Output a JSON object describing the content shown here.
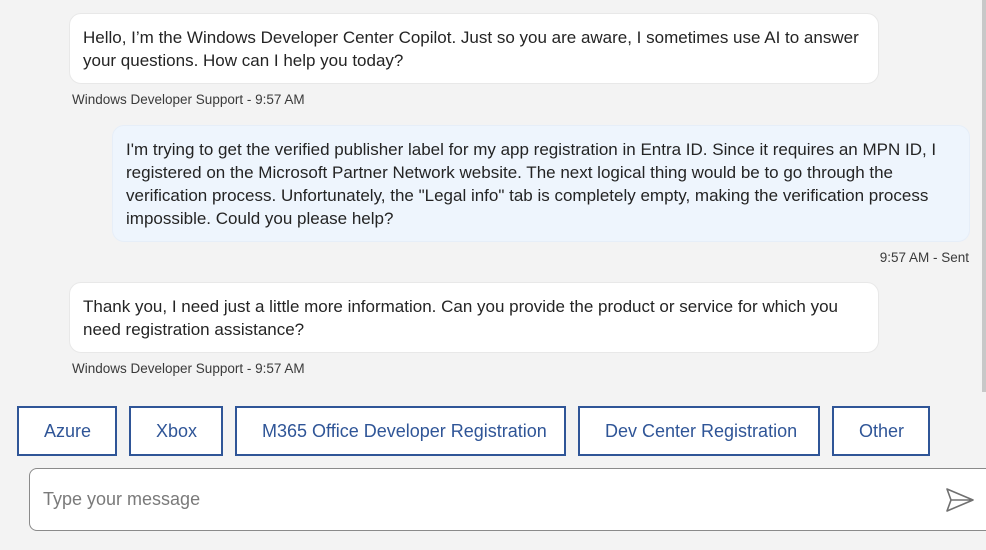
{
  "messages": [
    {
      "text": "Hello, I’m the Windows Developer Center Copilot. Just so you are aware, I sometimes use AI to answer your questions. How can I help you today?",
      "meta": "Windows Developer Support - 9:57 AM"
    },
    {
      "text": "I'm trying to get the verified publisher label for my app registration in Entra ID. Since it requires an MPN ID, I registered on the Microsoft Partner Network website. The next logical thing would be to go through the verification process. Unfortunately, the \"Legal info\" tab is completely empty, making the verification process impossible. Could you please help?",
      "meta": "9:57 AM - Sent"
    },
    {
      "text": "Thank you, I need just a little more information. Can you provide the product or service for which you need registration assistance?",
      "meta": "Windows Developer Support - 9:57 AM"
    }
  ],
  "suggested_actions": [
    "Azure",
    "Xbox",
    "M365 Office Developer Registration",
    "Dev Center Registration",
    "Other"
  ],
  "composer": {
    "placeholder": "Type your message"
  },
  "colors": {
    "accent": "#2f5597",
    "user_bubble": "#eef5fd",
    "bot_bubble": "#ffffff",
    "background": "#f3f3f3"
  },
  "icons": {
    "send": "send-icon"
  }
}
